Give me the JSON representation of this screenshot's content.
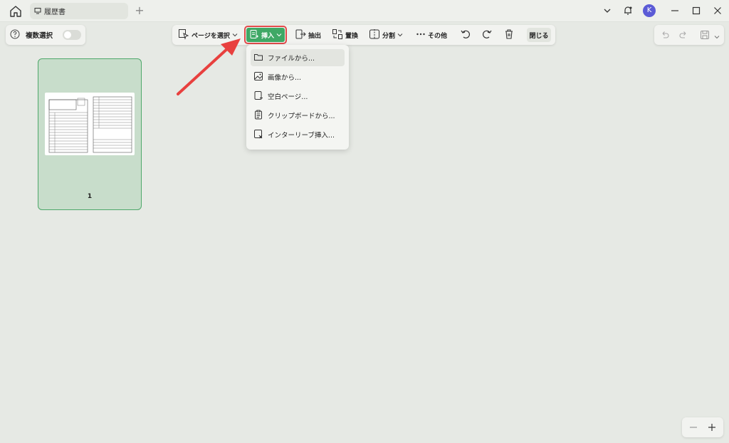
{
  "titlebar": {
    "tab_title": "履歴書",
    "avatar_initial": "K"
  },
  "left_panel": {
    "multi_select_label": "複数選択",
    "multi_select_on": false
  },
  "toolbar": {
    "select_pages": "ページを選択",
    "insert": "挿入",
    "extract": "抽出",
    "replace": "置換",
    "split": "分割",
    "more": "その他",
    "close": "閉じる"
  },
  "insert_menu": {
    "items": [
      {
        "label": "ファイルから...",
        "icon": "folder-icon"
      },
      {
        "label": "画像から...",
        "icon": "image-icon"
      },
      {
        "label": "空白ページ...",
        "icon": "blank-page-icon"
      },
      {
        "label": "クリップボードから...",
        "icon": "clipboard-icon"
      },
      {
        "label": "インターリーブ挿入...",
        "icon": "interleave-icon"
      }
    ],
    "highlighted_index": 0
  },
  "pages": [
    {
      "number": "1"
    }
  ],
  "colors": {
    "accent_green": "#3fa865",
    "highlight_red": "#e14a4a",
    "selected_page_bg": "#c8ddcb"
  }
}
